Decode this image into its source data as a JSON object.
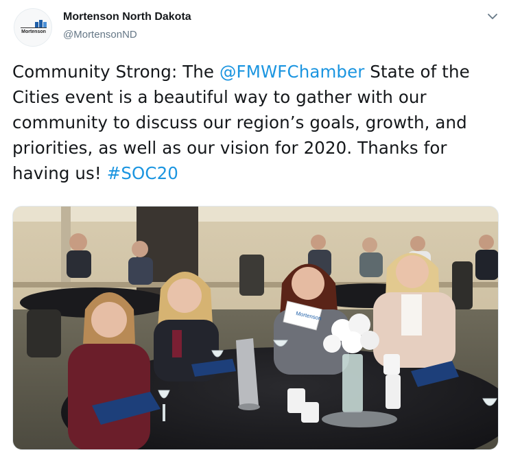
{
  "account": {
    "display_name": "Mortenson North Dakota",
    "handle": "@MortensonND",
    "avatar_logo_text": "Mortenson"
  },
  "tweet": {
    "text_parts": {
      "part1": "Community Strong: The ",
      "mention": "@FMWFChamber",
      "part2": " State of the Cities event is a beautiful way to gather with our community to discuss our region’s goals, growth, and priorities, as well as our vision for 2020. Thanks for having us! ",
      "hashtag": "#SOC20"
    }
  },
  "photo": {
    "table_card_text": "Mortenson",
    "description_icon": "event-photo"
  },
  "icons": {
    "caret": "chevron-down-icon"
  },
  "colors": {
    "link": "#1b95e0",
    "secondary_text": "#657786",
    "primary_text": "#14171a"
  }
}
